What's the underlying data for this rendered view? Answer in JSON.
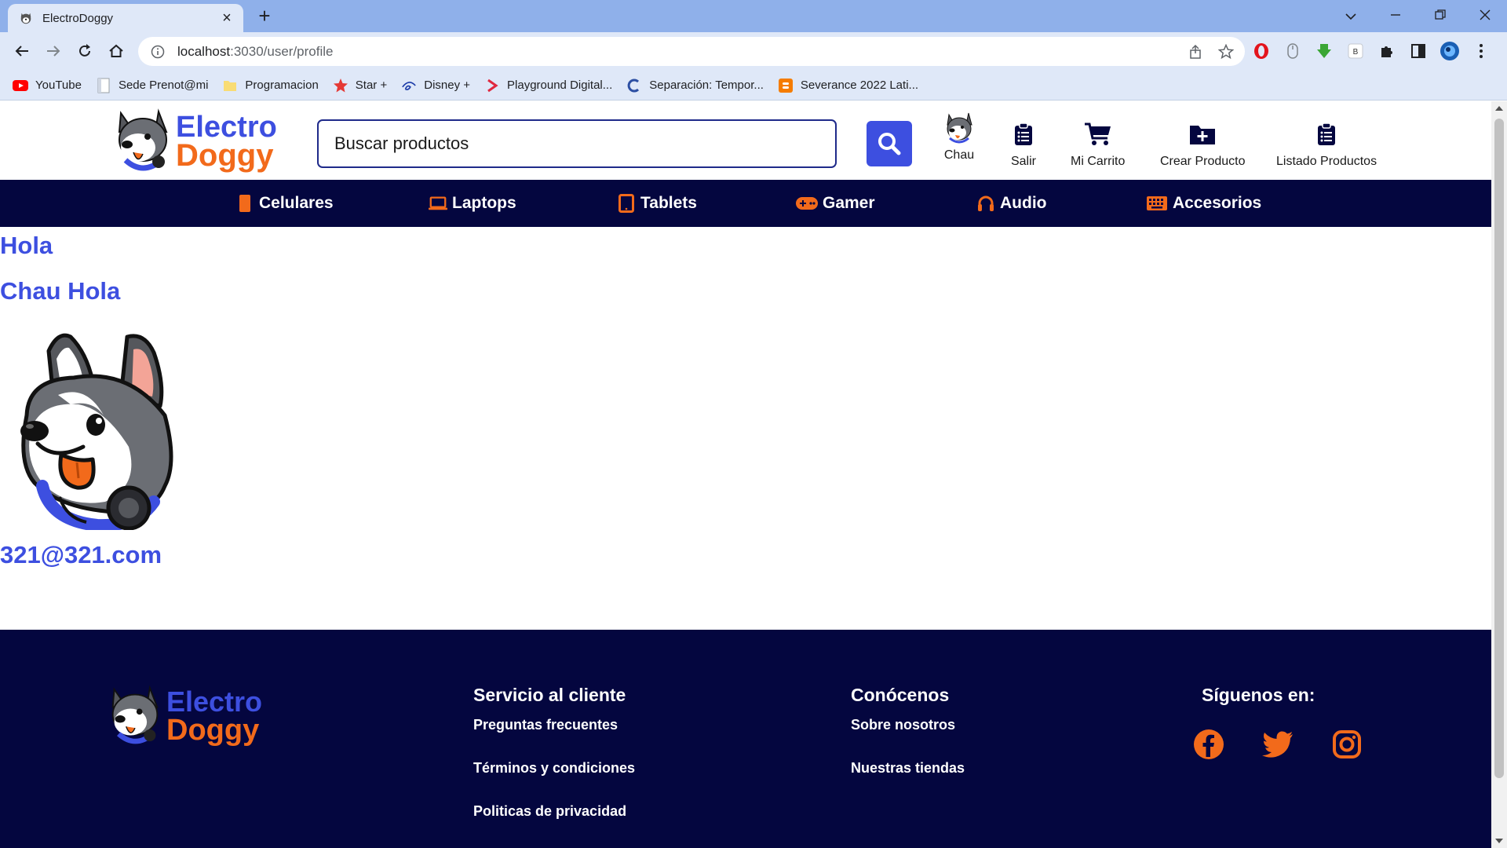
{
  "browser": {
    "tab_title": "ElectroDoggy",
    "url_host": "localhost",
    "url_path": ":3030/user/profile",
    "bookmarks": [
      {
        "label": "YouTube",
        "icon": "youtube-icon"
      },
      {
        "label": "Sede Prenot@mi",
        "icon": "page-icon"
      },
      {
        "label": "Programacion",
        "icon": "folder-icon"
      },
      {
        "label": "Star +",
        "icon": "star-plus-icon"
      },
      {
        "label": "Disney +",
        "icon": "disney-icon"
      },
      {
        "label": "Playground Digital...",
        "icon": "playground-icon"
      },
      {
        "label": "Separación: Tempor...",
        "icon": "c-icon"
      },
      {
        "label": "Severance 2022 Lati...",
        "icon": "blogger-icon"
      }
    ]
  },
  "header": {
    "logo_line1": "Electro",
    "logo_line2": "Doggy",
    "search_placeholder": "Buscar productos",
    "user_label": "Chau",
    "logout_label": "Salir",
    "cart_label": "Mi Carrito",
    "create_label": "Crear Producto",
    "list_label": "Listado Productos"
  },
  "categories": [
    {
      "label": "Celulares",
      "icon": "phone-icon"
    },
    {
      "label": "Laptops",
      "icon": "laptop-icon"
    },
    {
      "label": "Tablets",
      "icon": "tablet-icon"
    },
    {
      "label": "Gamer",
      "icon": "gamepad-icon"
    },
    {
      "label": "Audio",
      "icon": "headphones-icon"
    },
    {
      "label": "Accesorios",
      "icon": "keyboard-icon"
    }
  ],
  "profile": {
    "greeting": "Hola",
    "full_name": "Chau Hola",
    "email": "321@321.com"
  },
  "footer": {
    "logo_line1": "Electro",
    "logo_line2": "Doggy",
    "service": {
      "title": "Servicio al cliente",
      "links": [
        "Preguntas frecuentes",
        "Términos y condiciones",
        "Politicas de privacidad"
      ]
    },
    "about": {
      "title": "Conócenos",
      "links": [
        "Sobre nosotros",
        "Nuestras tiendas"
      ]
    },
    "social": {
      "title": "Síguenos en:",
      "icons": [
        "facebook-icon",
        "twitter-icon",
        "instagram-icon"
      ]
    }
  },
  "colors": {
    "brand_blue": "#3d4fe0",
    "brand_orange": "#f26a1b",
    "navy": "#04063f"
  }
}
